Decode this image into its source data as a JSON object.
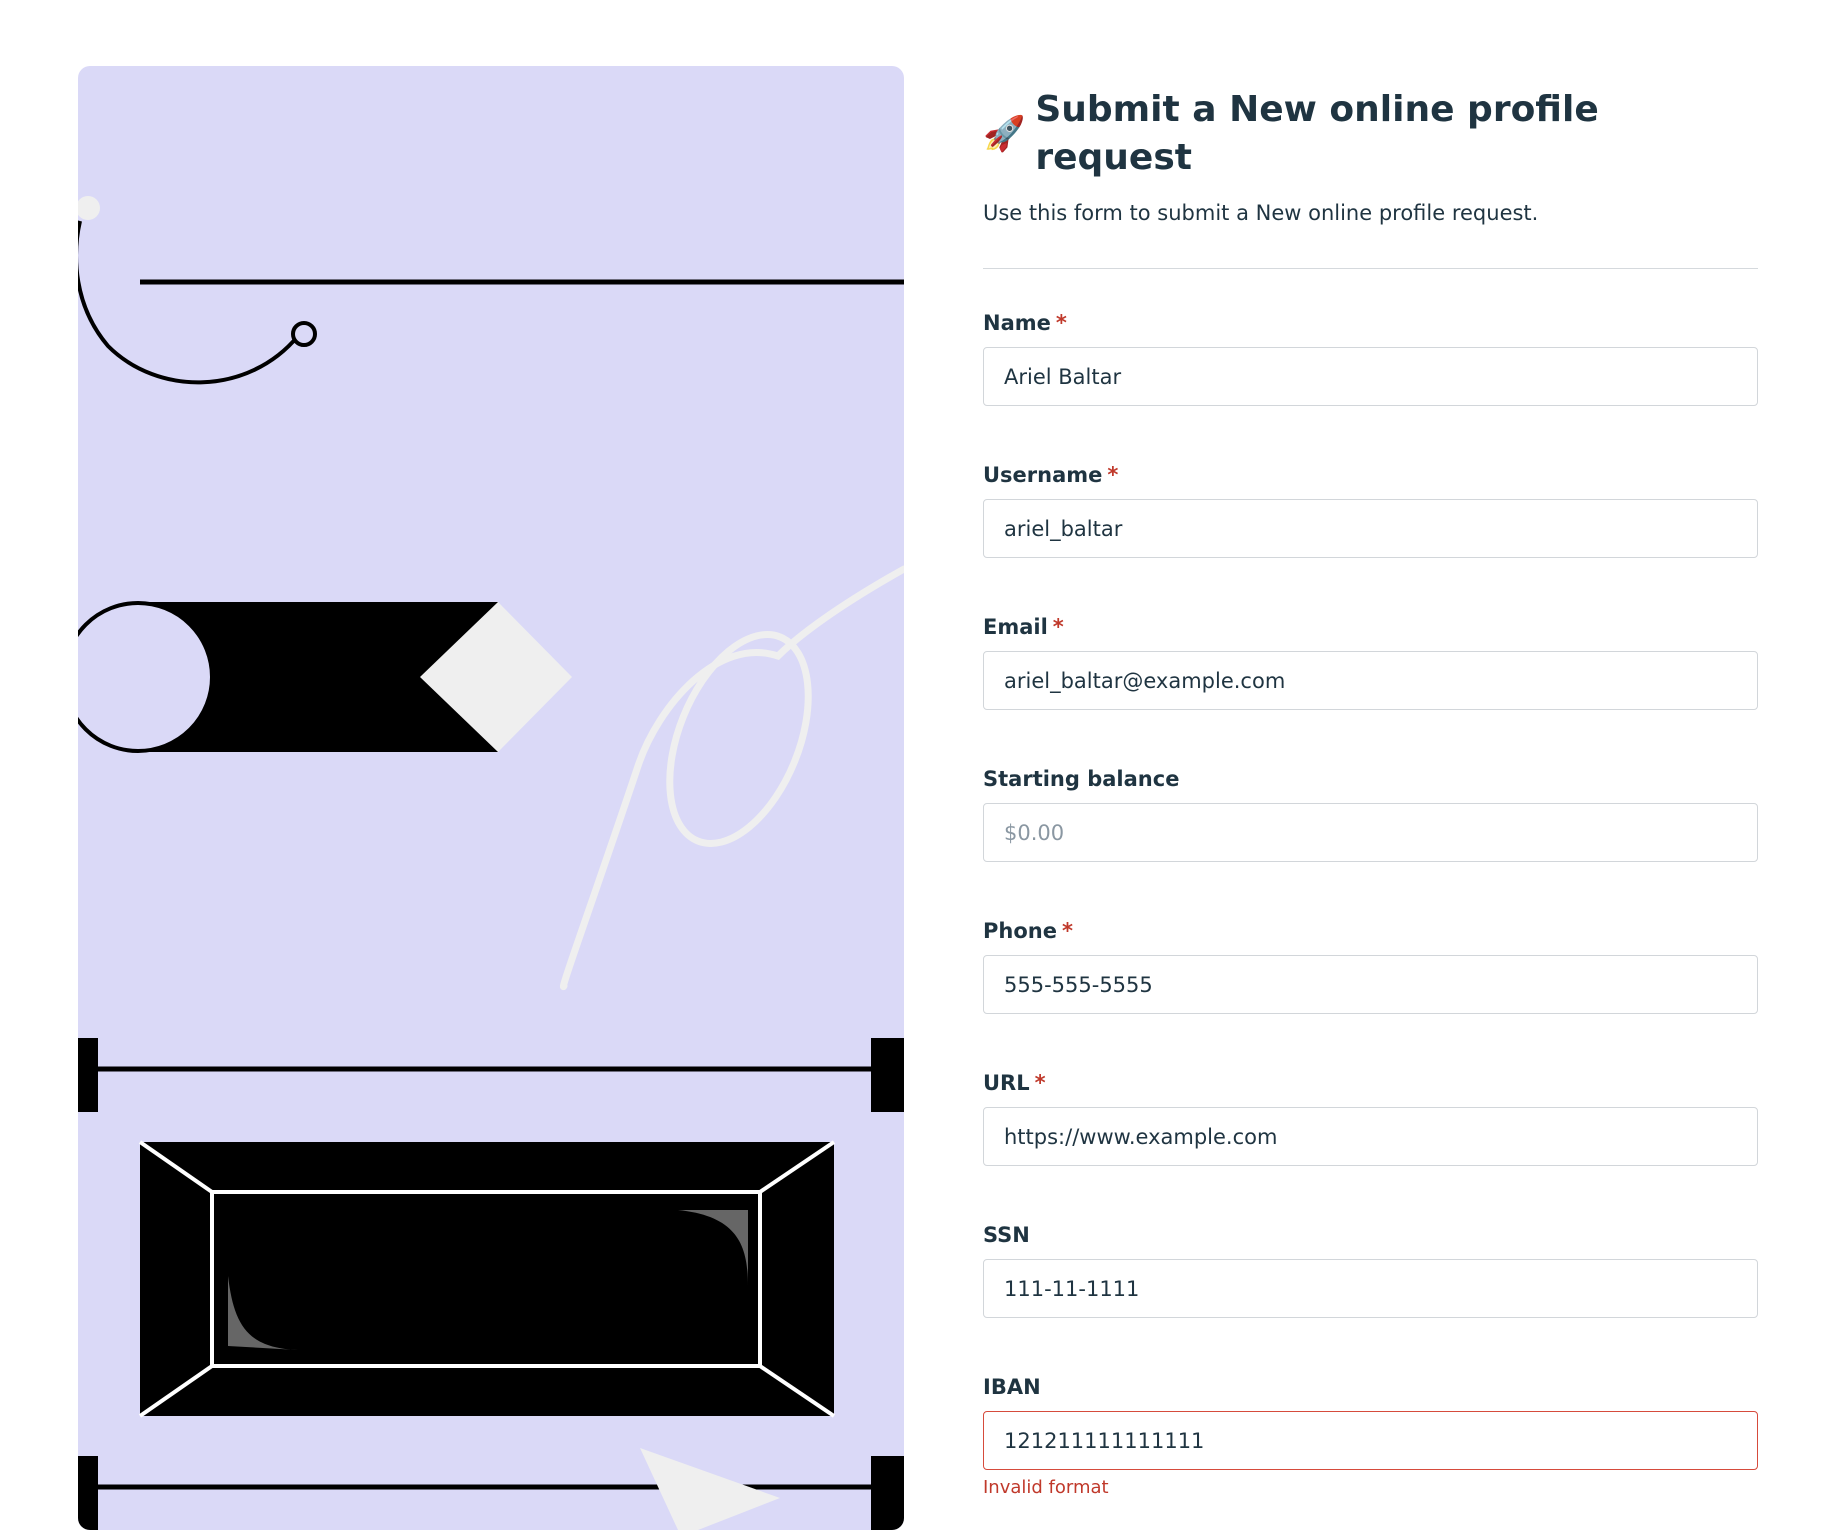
{
  "header": {
    "icon": "rocket-icon",
    "title": "Submit a New online profile request",
    "subtitle": "Use this form to submit a New online profile request."
  },
  "fields": [
    {
      "label": "Name",
      "required": true,
      "value": "Ariel Baltar",
      "placeholder": ""
    },
    {
      "label": "Username",
      "required": true,
      "value": "ariel_baltar",
      "placeholder": ""
    },
    {
      "label": "Email",
      "required": true,
      "value": "ariel_baltar@example.com",
      "placeholder": ""
    },
    {
      "label": "Starting balance",
      "required": false,
      "value": "",
      "placeholder": "$0.00"
    },
    {
      "label": "Phone",
      "required": true,
      "value": "555-555-5555",
      "placeholder": ""
    },
    {
      "label": "URL",
      "required": true,
      "value": "https://www.example.com",
      "placeholder": ""
    },
    {
      "label": "SSN",
      "required": false,
      "value": "111-11-1111",
      "placeholder": ""
    },
    {
      "label": "IBAN",
      "required": false,
      "value": "121211111111111",
      "placeholder": "",
      "error": "Invalid format"
    }
  ],
  "required_marker": "*",
  "colors": {
    "art_background": "#dad9f7",
    "error": "#c0392b",
    "text": "#1f3441"
  }
}
